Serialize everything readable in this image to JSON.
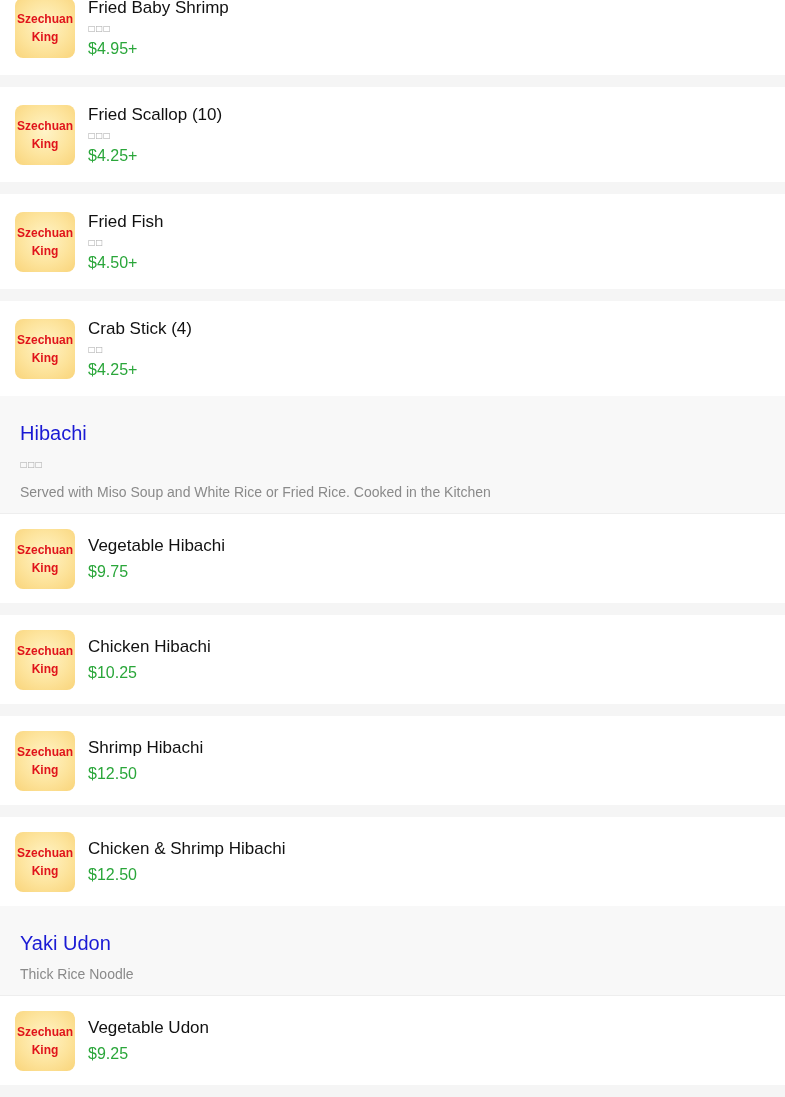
{
  "sections": [
    {
      "items": [
        {
          "logo_text": "Szechuan King",
          "name": "Fried Baby Shrimp",
          "subtitle": "□□□",
          "price": "$4.95+"
        },
        {
          "logo_text": "Szechuan King",
          "name": "Fried Scallop (10)",
          "subtitle": "□□□",
          "price": "$4.25+"
        },
        {
          "logo_text": "Szechuan King",
          "name": "Fried Fish",
          "subtitle": "□□",
          "price": "$4.50+"
        },
        {
          "logo_text": "Szechuan King",
          "name": "Crab Stick (4)",
          "subtitle": "□□",
          "price": "$4.25+"
        }
      ]
    },
    {
      "title": "Hibachi",
      "subtitle": "□□□",
      "description": "Served with Miso Soup and White Rice or Fried Rice. Cooked in the Kitchen",
      "items": [
        {
          "logo_text": "Szechuan King",
          "name": "Vegetable Hibachi",
          "price": "$9.75"
        },
        {
          "logo_text": "Szechuan King",
          "name": "Chicken Hibachi",
          "price": "$10.25"
        },
        {
          "logo_text": "Szechuan King",
          "name": "Shrimp Hibachi",
          "price": "$12.50"
        },
        {
          "logo_text": "Szechuan King",
          "name": "Chicken & Shrimp Hibachi",
          "price": "$12.50"
        }
      ]
    },
    {
      "title": "Yaki Udon",
      "description": "Thick Rice Noodle",
      "items": [
        {
          "logo_text": "Szechuan King",
          "name": "Vegetable Udon",
          "price": "$9.25"
        }
      ]
    }
  ]
}
